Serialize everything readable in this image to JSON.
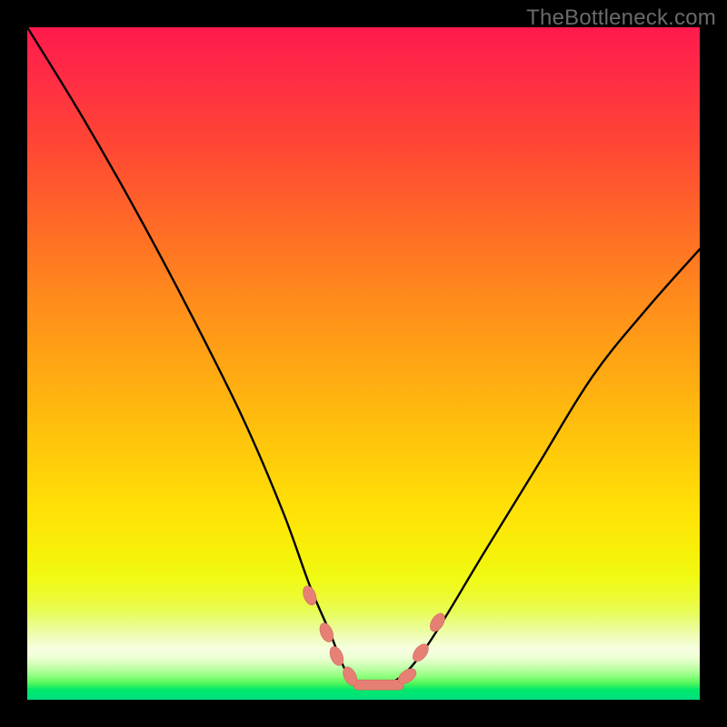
{
  "watermark": "TheBottleneck.com",
  "colors": {
    "frame_bg": "#000000",
    "curve_stroke": "#000000",
    "marker_fill": "#e78074",
    "marker_stroke": "#cf6a5e",
    "segment_fill": "#e78074"
  },
  "chart_data": {
    "type": "line",
    "title": "",
    "xlabel": "",
    "ylabel": "",
    "xlim": [
      0,
      100
    ],
    "ylim": [
      0,
      100
    ],
    "note": "Axes are unlabeled. Values are estimated from pixel positions: x = horizontal %, y = vertical % from bottom (0 = bottom/green, 100 = top/red).",
    "series": [
      {
        "name": "bottleneck-curve",
        "x": [
          0,
          8,
          16,
          24,
          32,
          38,
          42,
          45,
          47,
          49,
          52,
          55,
          58,
          62,
          68,
          76,
          84,
          92,
          100
        ],
        "y": [
          100,
          87,
          73,
          58,
          42,
          28,
          17,
          10,
          5,
          2,
          2,
          3,
          6,
          12,
          22,
          35,
          48,
          58,
          67
        ]
      }
    ],
    "markers": {
      "note": "Salmon oval markers near the trough of the curve, plus a horizontal salmon segment at the minimum.",
      "points": [
        {
          "x": 42.0,
          "y": 15.5
        },
        {
          "x": 44.5,
          "y": 10.0
        },
        {
          "x": 46.0,
          "y": 6.5
        },
        {
          "x": 48.0,
          "y": 3.5
        },
        {
          "x": 56.5,
          "y": 3.5
        },
        {
          "x": 58.5,
          "y": 7.0
        },
        {
          "x": 61.0,
          "y": 11.5
        }
      ],
      "flat_segment": {
        "x_start": 48.5,
        "x_end": 56.0,
        "y": 2.2
      }
    }
  }
}
